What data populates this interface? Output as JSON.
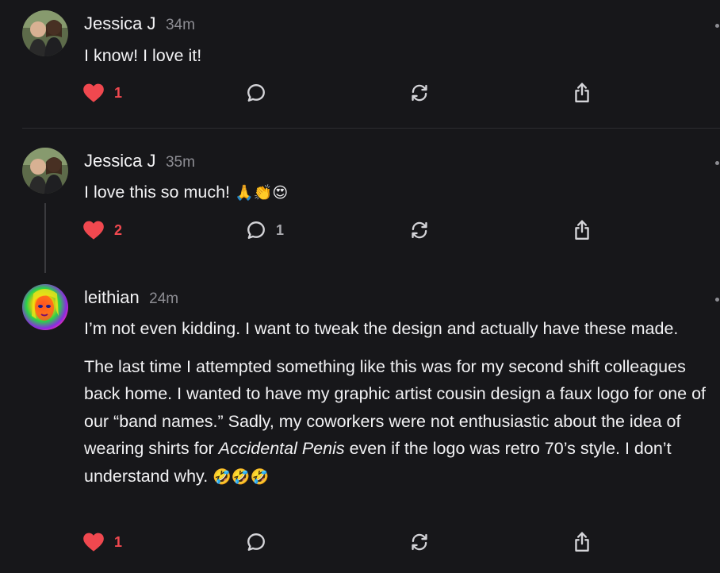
{
  "posts": [
    {
      "author": "Jessica J",
      "time": "34m",
      "paragraphs": [
        "I know! I love it!"
      ],
      "emoji": "",
      "likes": "1",
      "replies": ""
    },
    {
      "author": "Jessica J",
      "time": "35m",
      "paragraphs": [
        "I love this so much!"
      ],
      "emoji": "🙏👏😍",
      "likes": "2",
      "replies": "1"
    },
    {
      "author": "leithian",
      "time": "24m",
      "paragraph1": "I’m not even kidding. I want to tweak the design and actually have these made.",
      "paragraph2_before": "The last time I attempted something like this was for my second shift colleagues back home. I wanted to have my graphic artist cousin design a faux logo for one of our “band names.” Sadly, my coworkers were not enthusiastic about the idea of wearing shirts for ",
      "paragraph2_italic": "Accidental Penis",
      "paragraph2_after": " even if the logo was retro 70’s style. I don’t understand why. ",
      "emoji": "🤣🤣🤣",
      "likes": "1",
      "replies": ""
    }
  ],
  "icons": {
    "like": "heart-icon",
    "reply": "comment-icon",
    "repost": "repost-icon",
    "share": "share-icon",
    "more": "more-options-icon"
  },
  "colors": {
    "background": "#17171a",
    "like": "#f0484f",
    "muted": "#8d8d93",
    "text": "#f2f2f4"
  }
}
